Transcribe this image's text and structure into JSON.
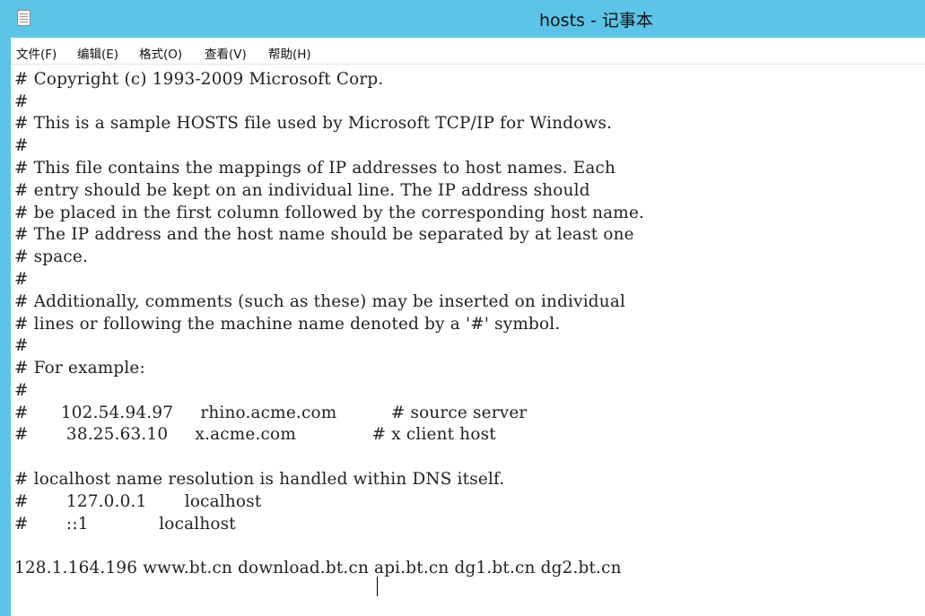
{
  "window": {
    "title": "hosts - 记事本"
  },
  "menu": {
    "items": [
      "文件(F)",
      "编辑(E)",
      "格式(O)",
      "查看(V)",
      "帮助(H)"
    ]
  },
  "editor": {
    "lines": [
      "# Copyright (c) 1993-2009 Microsoft Corp.",
      "#",
      "# This is a sample HOSTS file used by Microsoft TCP/IP for Windows.",
      "#",
      "# This file contains the mappings of IP addresses to host names. Each",
      "# entry should be kept on an individual line. The IP address should",
      "# be placed in the first column followed by the corresponding host name.",
      "# The IP address and the host name should be separated by at least one",
      "# space.",
      "#",
      "# Additionally, comments (such as these) may be inserted on individual",
      "# lines or following the machine name denoted by a '#' symbol.",
      "#",
      "# For example:",
      "#",
      "#      102.54.94.97     rhino.acme.com          # source server",
      "#       38.25.63.10     x.acme.com              # x client host",
      "",
      "# localhost name resolution is handled within DNS itself.",
      "#       127.0.0.1       localhost",
      "#       ::1             localhost",
      "",
      "128.1.164.196 www.bt.cn download.bt.cn api.bt.cn dg1.bt.cn dg2.bt.cn"
    ]
  }
}
